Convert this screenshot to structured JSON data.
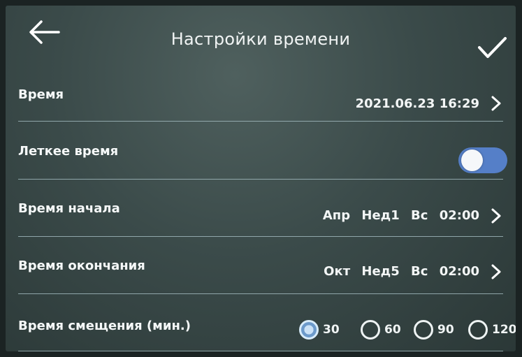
{
  "header": {
    "title": "Настройки времени",
    "back_icon": "arrow-left-icon",
    "confirm_icon": "checkmark-icon"
  },
  "rows": [
    {
      "label": "Время",
      "value": "2021.06.23 16:29",
      "icon": "chevron-right-icon"
    },
    {
      "label": "Леткее время",
      "toggle_on": true,
      "icon": "toggle-switch"
    },
    {
      "label": "Время начала",
      "value_parts": [
        "Апр",
        "Нед1",
        "Вс",
        "02:00"
      ],
      "icon": "chevron-right-icon"
    },
    {
      "label": "Время окончания",
      "value_parts": [
        "Окт",
        "Нед5",
        "Вс",
        "02:00"
      ],
      "icon": "chevron-right-icon"
    },
    {
      "label": "Время смещения (мин.)",
      "options": [
        "30",
        "60",
        "90",
        "120"
      ],
      "selected": "30"
    }
  ],
  "colors": {
    "accent": "#557fc8",
    "screen_bg": "#3b4b4a",
    "text": "#f1f4f4"
  }
}
